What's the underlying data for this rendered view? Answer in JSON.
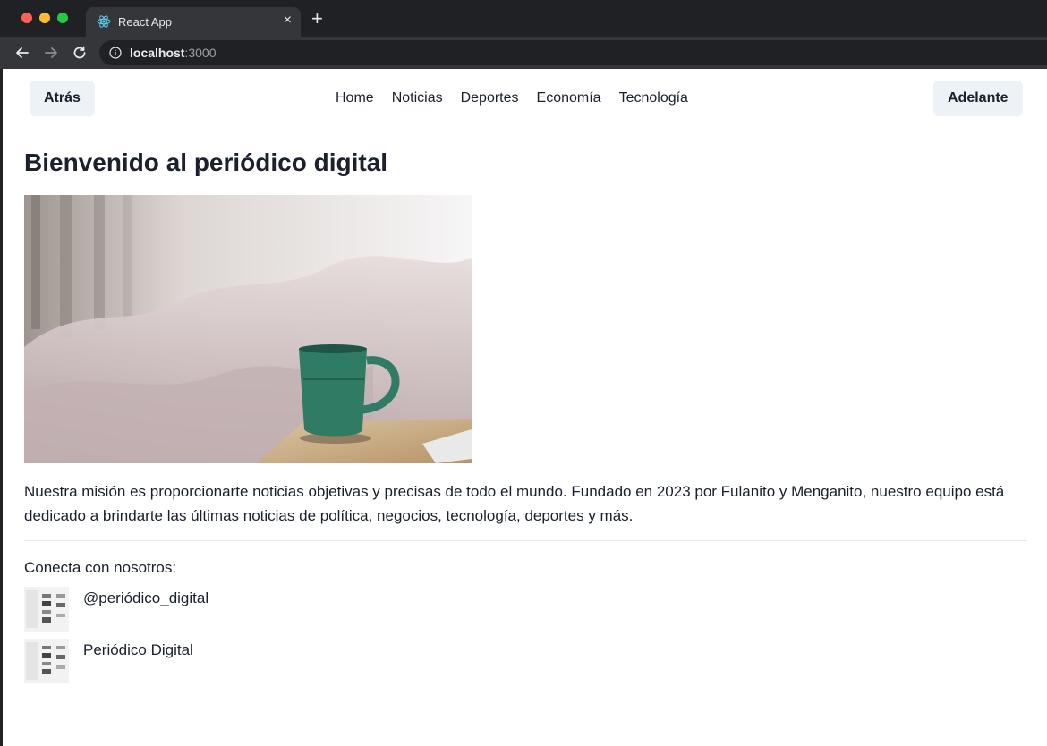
{
  "browser": {
    "tab_title": "React App",
    "new_tab_symbol": "+",
    "close_symbol": "×",
    "url_host": "localhost",
    "url_port": ":3000"
  },
  "header": {
    "back_label": "Atrás",
    "forward_label": "Adelante",
    "nav": [
      "Home",
      "Noticias",
      "Deportes",
      "Economía",
      "Tecnología"
    ]
  },
  "main": {
    "title": "Bienvenido al periódico digital",
    "mission": "Nuestra misión es proporcionarte noticias objetivas y precisas de todo el mundo. Fundado en 2023 por Fulanito y Menganito, nuestro equipo está dedicado a brindarte las últimas noticias de política, negocios, tecnología, deportes y más.",
    "connect_label": "Conecta con nosotros:",
    "social": [
      {
        "handle": "@periódico_digital"
      },
      {
        "handle": "Periódico Digital"
      }
    ]
  },
  "colors": {
    "chrome_dark": "#202124",
    "chrome_tab": "#35363a",
    "button_bg": "#edf2f7",
    "text": "#1a202c"
  }
}
